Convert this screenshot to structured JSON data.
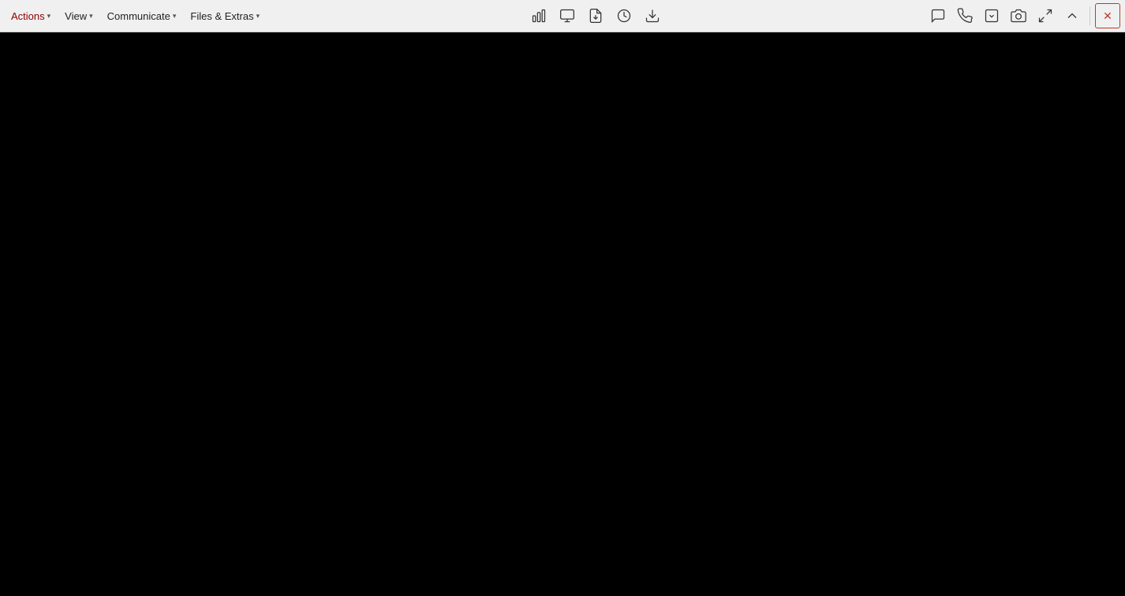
{
  "toolbar": {
    "menus": [
      {
        "id": "actions",
        "label": "Actions",
        "has_chevron": true,
        "color": "dark-red"
      },
      {
        "id": "view",
        "label": "View",
        "has_chevron": true,
        "color": "normal"
      },
      {
        "id": "communicate",
        "label": "Communicate",
        "has_chevron": true,
        "color": "normal"
      },
      {
        "id": "files-extras",
        "label": "Files & Extras",
        "has_chevron": true,
        "color": "normal"
      }
    ],
    "center_icons": [
      {
        "id": "stats",
        "tooltip": "Statistics"
      },
      {
        "id": "display",
        "tooltip": "Display"
      },
      {
        "id": "file-transfer",
        "tooltip": "File Transfer"
      },
      {
        "id": "session-info",
        "tooltip": "Session Info"
      },
      {
        "id": "download",
        "tooltip": "Download"
      }
    ],
    "right_icons": [
      {
        "id": "chat",
        "tooltip": "Chat"
      },
      {
        "id": "phone",
        "tooltip": "Phone"
      },
      {
        "id": "remote-control",
        "tooltip": "Remote Control"
      },
      {
        "id": "screenshot",
        "tooltip": "Screenshot"
      },
      {
        "id": "fullscreen",
        "tooltip": "Fullscreen"
      },
      {
        "id": "chevron-up",
        "tooltip": "Up"
      }
    ],
    "close_label": "✕"
  },
  "main": {
    "background": "#000000"
  }
}
